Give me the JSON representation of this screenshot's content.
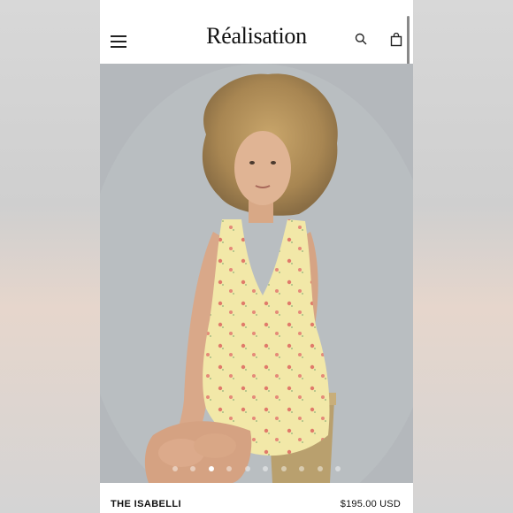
{
  "header": {
    "brand": "Réalisation",
    "menu_icon": "hamburger-menu-icon",
    "search_icon": "search-icon",
    "bag_icon": "shopping-bag-icon"
  },
  "gallery": {
    "dot_count": 10,
    "active_index": 2
  },
  "product": {
    "name": "THE ISABELLI",
    "price": "$195.00 USD"
  }
}
